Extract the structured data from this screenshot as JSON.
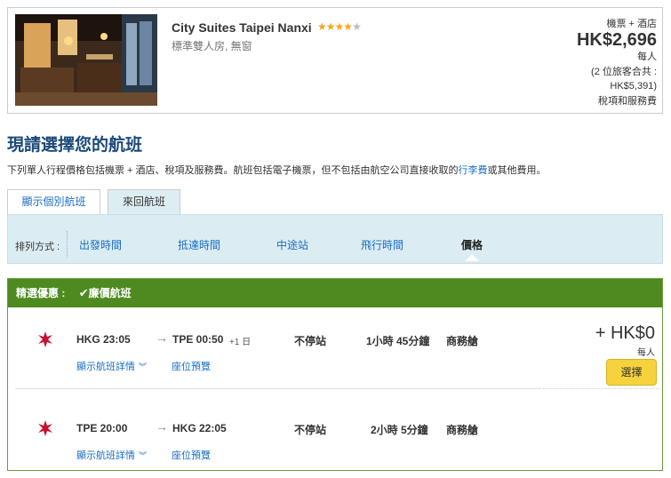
{
  "hotel": {
    "name": "City Suites Taipei Nanxi",
    "stars": 4,
    "room_type": "標準雙人房, 無窗",
    "package_label": "機票 + 酒店",
    "price": "HK$2,696",
    "per_person": "每人",
    "total_prefix": "(2 位旅客合共 :",
    "total_value": "HK$5,391)",
    "taxes": "稅項和服務費"
  },
  "heading": {
    "title": "現請選擇您的航班",
    "notice_before": "下列單人行程價格包括機票 + 酒店、稅項及服務費。航班包括電子機票，但不包括由航空公司直接收取的",
    "notice_link": "行李費",
    "notice_after": "或其他費用。"
  },
  "tabs": [
    {
      "label": "顯示個別航班",
      "active": false
    },
    {
      "label": "來回航班",
      "active": true
    }
  ],
  "sort": {
    "label": "排列方式 :",
    "options": [
      {
        "label": "出發時間",
        "active": false
      },
      {
        "label": "抵達時間",
        "active": false
      },
      {
        "label": "中途站",
        "active": false
      },
      {
        "label": "飛行時間",
        "active": false
      },
      {
        "label": "價格",
        "active": true
      }
    ]
  },
  "result": {
    "deal_label": "精選優惠 :",
    "deal_tag": "廉價航班",
    "fare": "+ HK$0",
    "fare_per": "每人",
    "select_label": "選擇",
    "legs": [
      {
        "dep": "HKG 23:05",
        "arr": "TPE 00:50",
        "plus_day": "+1 日",
        "stops": "不停站",
        "duration": "1小時 45分鐘",
        "cabin": "商務艙",
        "details": "顯示航班詳情",
        "seat": "座位預覽"
      },
      {
        "dep": "TPE 20:00",
        "arr": "HKG 22:05",
        "plus_day": "",
        "stops": "不停站",
        "duration": "2小時 5分鐘",
        "cabin": "商務艙",
        "details": "顯示航班詳情",
        "seat": "座位預覽"
      }
    ]
  },
  "colors": {
    "brand_blue": "#1b4a7a",
    "link_blue": "#1a6ec0",
    "deal_green": "#4e8a20",
    "select_yellow": "#f6d33c",
    "airline_red": "#c8102e"
  }
}
